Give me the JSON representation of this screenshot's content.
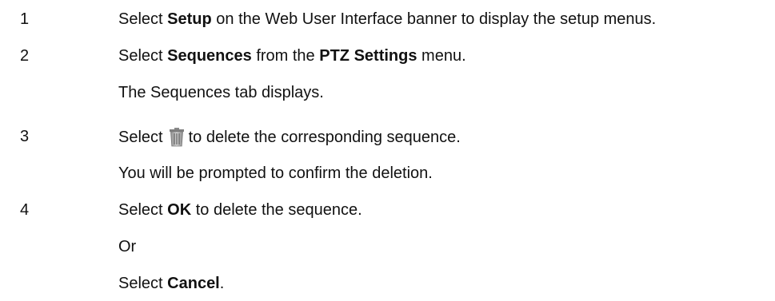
{
  "steps": [
    {
      "number": "1",
      "line": {
        "a": "Select ",
        "b": "Setup",
        "c": " on the Web User Interface banner to display the setup menus."
      }
    },
    {
      "number": "2",
      "line": {
        "a": "Select ",
        "b": "Sequences",
        "c": " from the ",
        "d": "PTZ Settings",
        "e": " menu."
      },
      "note": "The Sequences tab displays."
    },
    {
      "number": "3",
      "line": {
        "a": "Select",
        "icon": "trash-icon",
        "c": "to delete the corresponding sequence."
      },
      "note": "You will be prompted to confirm the deletion."
    },
    {
      "number": "4",
      "line": {
        "a": "Select ",
        "b": "OK",
        "c": " to delete the sequence."
      },
      "alt": "Or",
      "alt_line": {
        "a": "Select ",
        "b": "Cancel",
        "c": "."
      }
    }
  ]
}
